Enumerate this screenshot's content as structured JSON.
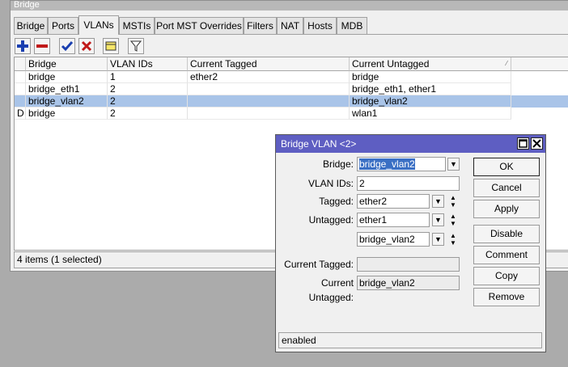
{
  "window": {
    "title": "Bridge"
  },
  "tabs": [
    {
      "label": "Bridge"
    },
    {
      "label": "Ports"
    },
    {
      "label": "VLANs"
    },
    {
      "label": "MSTIs"
    },
    {
      "label": "Port MST Overrides"
    },
    {
      "label": "Filters"
    },
    {
      "label": "NAT"
    },
    {
      "label": "Hosts"
    },
    {
      "label": "MDB"
    }
  ],
  "toolbar": {
    "icons": [
      "add-icon",
      "remove-icon",
      "enable-check-icon",
      "disable-x-icon",
      "comment-note-icon",
      "filter-funnel-icon"
    ]
  },
  "table": {
    "columns": [
      "Bridge",
      "VLAN IDs",
      "Current Tagged",
      "Current Untagged"
    ],
    "rows": [
      {
        "flag": "",
        "bridge": "bridge",
        "vlan_ids": "1",
        "tagged": "ether2",
        "untagged": "bridge"
      },
      {
        "flag": "",
        "bridge": "bridge_eth1",
        "vlan_ids": "2",
        "tagged": "",
        "untagged": "bridge_eth1, ether1"
      },
      {
        "flag": "",
        "bridge": "bridge_vlan2",
        "vlan_ids": "2",
        "tagged": "",
        "untagged": "bridge_vlan2"
      },
      {
        "flag": "D",
        "bridge": "bridge",
        "vlan_ids": "2",
        "tagged": "",
        "untagged": "wlan1"
      }
    ]
  },
  "status": "4 items (1 selected)",
  "dialog": {
    "title": "Bridge VLAN <2>",
    "labels": {
      "bridge": "Bridge:",
      "vlan_ids": "VLAN IDs:",
      "tagged": "Tagged:",
      "untagged": "Untagged:",
      "current_tagged": "Current Tagged:",
      "current_untagged": "Current Untagged:"
    },
    "values": {
      "bridge": "bridge_vlan2",
      "vlan_ids": "2",
      "tagged": "ether2",
      "untagged_1": "ether1",
      "untagged_2": "bridge_vlan2",
      "current_tagged": "",
      "current_untagged": "bridge_vlan2"
    },
    "buttons": {
      "ok": "OK",
      "cancel": "Cancel",
      "apply": "Apply",
      "disable": "Disable",
      "comment": "Comment",
      "copy": "Copy",
      "remove": "Remove"
    },
    "status": "enabled"
  },
  "colors": {
    "dialog_title": "#5e5ec2",
    "selected_row": "#a9c4e8",
    "input_selection": "#3a6fc4"
  }
}
